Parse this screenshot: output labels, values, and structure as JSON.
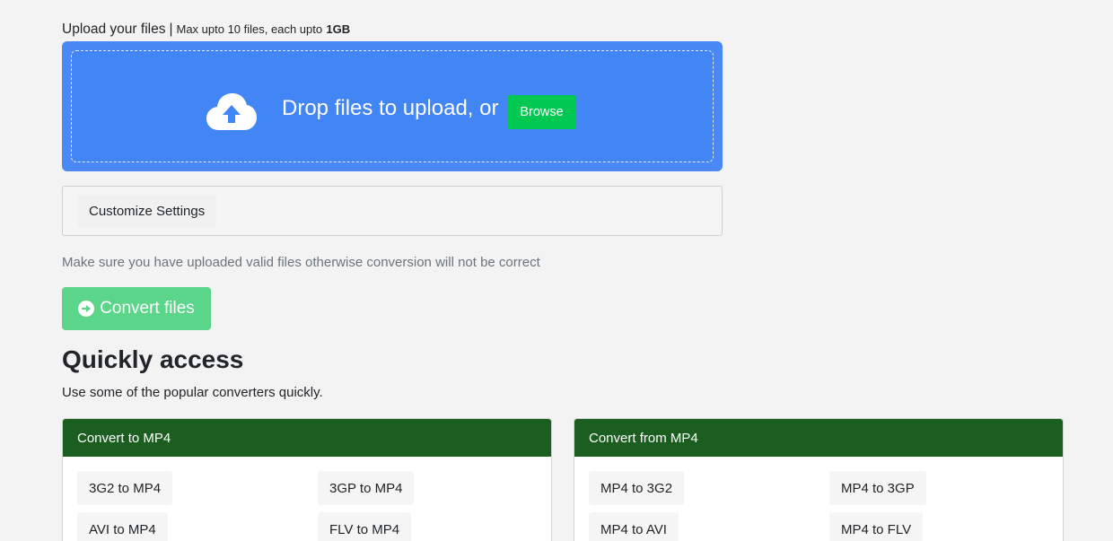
{
  "upload": {
    "label": "Upload your files",
    "separator": "|",
    "limit_text": "Max upto 10 files, each upto",
    "limit_size": "1GB",
    "drop_text": "Drop files to upload, or",
    "browse_label": "Browse",
    "icon": "cloud-upload-icon"
  },
  "settings": {
    "button_label": "Customize Settings"
  },
  "note": "Make sure you have uploaded valid files otherwise conversion will not be correct",
  "convert": {
    "label": "Convert files",
    "icon": "arrow-circle-right-icon"
  },
  "quick_access": {
    "title": "Quickly access",
    "subtitle": "Use some of the popular converters quickly.",
    "cards": [
      {
        "title": "Convert to MP4",
        "links": [
          "3G2 to MP4",
          "3GP to MP4",
          "AVI to MP4",
          "FLV to MP4"
        ]
      },
      {
        "title": "Convert from MP4",
        "links": [
          "MP4 to 3G2",
          "MP4 to 3GP",
          "MP4 to AVI",
          "MP4 to FLV"
        ]
      }
    ]
  },
  "colors": {
    "dropzone": "#4285f4",
    "browse": "#00c853",
    "convert": "#5ad58a",
    "card_header": "#1b5e20",
    "background": "#f3f3f3"
  }
}
